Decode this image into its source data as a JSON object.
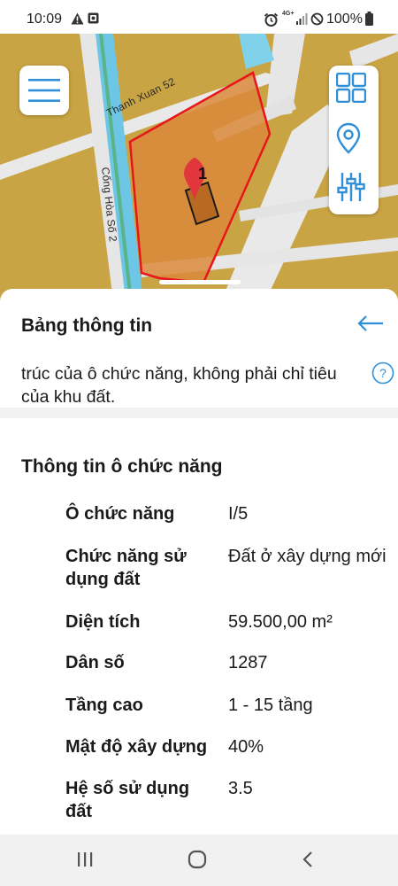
{
  "status_bar": {
    "time": "10:09",
    "network": "4G+",
    "battery": "100%",
    "icons": [
      "warning-icon",
      "image-icon",
      "alarm-icon",
      "signal-icon",
      "do-not-disturb-icon",
      "battery-icon"
    ]
  },
  "map": {
    "streets": [
      "Thanh Xuan 52",
      "Cống Hòa Số 2"
    ],
    "marker_label": "1",
    "colors": {
      "land": "#c9a444",
      "parcel_fill": "#d98a3a",
      "parcel_border": "#e8161b",
      "marker": "#e0363c",
      "water": "#6ec6e6",
      "road": "#e9e9e9"
    }
  },
  "toolbar": {
    "menu_icon": "hamburger-menu-icon",
    "tools": [
      "grid-layers-icon",
      "location-pin-icon",
      "filter-sliders-icon"
    ],
    "accent_color": "#2f8fd8"
  },
  "panel": {
    "title": "Bảng thông tin",
    "note": "trúc của ô chức năng, không phải chỉ tiêu của khu đất.",
    "section_title": "Thông tin ô chức năng",
    "rows": [
      {
        "label": "Ô chức năng",
        "value": "I/5"
      },
      {
        "label": "Chức năng sử dụng đất",
        "value": "Đất ở xây dựng mới"
      },
      {
        "label": "Diện tích",
        "value": "59.500,00 m²"
      },
      {
        "label": "Dân số",
        "value": "1287"
      },
      {
        "label": "Tầng cao",
        "value": "1 - 15 tầng"
      },
      {
        "label": "Mật độ xây dựng",
        "value": "40%"
      },
      {
        "label": "Hệ số sử dụng đất",
        "value": "3.5"
      }
    ]
  },
  "nav_bar": {
    "buttons": [
      "recent-apps-icon",
      "home-icon",
      "back-icon"
    ]
  }
}
